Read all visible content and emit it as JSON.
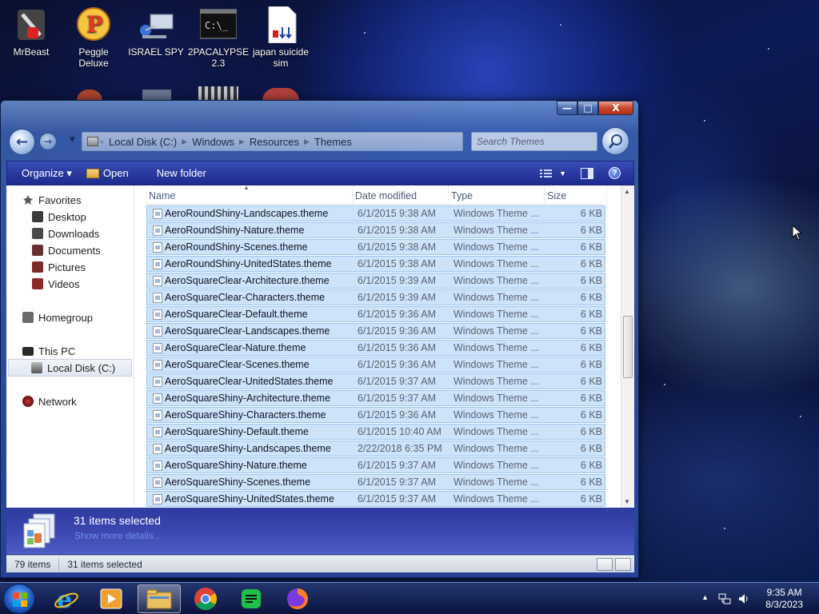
{
  "desktop": {
    "icons": [
      {
        "label": "MrBeast",
        "icon": "mrbeast-app-icon"
      },
      {
        "label": "Peggle Deluxe",
        "icon": "peggle-icon"
      },
      {
        "label": "ISRAEL SPY",
        "icon": "network-computer-icon"
      },
      {
        "label": "2PACALYPSE 2.3",
        "icon": "console-icon"
      },
      {
        "label": "japan suicide sim",
        "icon": "batch-file-icon"
      }
    ]
  },
  "window": {
    "title_buttons": {
      "minimize": "—",
      "maximize": "□",
      "close": "X"
    },
    "address": {
      "crumbs": [
        "Local Disk (C:)",
        "Windows",
        "Resources",
        "Themes"
      ],
      "overflow": "«"
    },
    "search": {
      "placeholder": "Search Themes"
    },
    "toolbar": {
      "organize": "Organize ▾",
      "open": "Open",
      "new_folder": "New folder",
      "help": "?"
    },
    "nav_pane": {
      "favorites": "Favorites",
      "desktop": "Desktop",
      "downloads": "Downloads",
      "documents": "Documents",
      "pictures": "Pictures",
      "videos": "Videos",
      "homegroup": "Homegroup",
      "this_pc": "This PC",
      "local_disk": "Local Disk (C:)",
      "network": "Network"
    },
    "columns": {
      "name": "Name",
      "date": "Date modified",
      "type": "Type",
      "size": "Size"
    },
    "files": [
      {
        "name": "AeroRoundShiny-Landscapes.theme",
        "date": "6/1/2015 9:38 AM",
        "type": "Windows Theme ...",
        "size": "6 KB"
      },
      {
        "name": "AeroRoundShiny-Nature.theme",
        "date": "6/1/2015 9:38 AM",
        "type": "Windows Theme ...",
        "size": "6 KB"
      },
      {
        "name": "AeroRoundShiny-Scenes.theme",
        "date": "6/1/2015 9:38 AM",
        "type": "Windows Theme ...",
        "size": "6 KB"
      },
      {
        "name": "AeroRoundShiny-UnitedStates.theme",
        "date": "6/1/2015 9:38 AM",
        "type": "Windows Theme ...",
        "size": "6 KB"
      },
      {
        "name": "AeroSquareClear-Architecture.theme",
        "date": "6/1/2015 9:39 AM",
        "type": "Windows Theme ...",
        "size": "6 KB"
      },
      {
        "name": "AeroSquareClear-Characters.theme",
        "date": "6/1/2015 9:39 AM",
        "type": "Windows Theme ...",
        "size": "6 KB"
      },
      {
        "name": "AeroSquareClear-Default.theme",
        "date": "6/1/2015 9:36 AM",
        "type": "Windows Theme ...",
        "size": "6 KB"
      },
      {
        "name": "AeroSquareClear-Landscapes.theme",
        "date": "6/1/2015 9:36 AM",
        "type": "Windows Theme ...",
        "size": "6 KB"
      },
      {
        "name": "AeroSquareClear-Nature.theme",
        "date": "6/1/2015 9:36 AM",
        "type": "Windows Theme ...",
        "size": "6 KB"
      },
      {
        "name": "AeroSquareClear-Scenes.theme",
        "date": "6/1/2015 9:36 AM",
        "type": "Windows Theme ...",
        "size": "6 KB"
      },
      {
        "name": "AeroSquareClear-UnitedStates.theme",
        "date": "6/1/2015 9:37 AM",
        "type": "Windows Theme ...",
        "size": "6 KB"
      },
      {
        "name": "AeroSquareShiny-Architecture.theme",
        "date": "6/1/2015 9:37 AM",
        "type": "Windows Theme ...",
        "size": "6 KB"
      },
      {
        "name": "AeroSquareShiny-Characters.theme",
        "date": "6/1/2015 9:36 AM",
        "type": "Windows Theme ...",
        "size": "6 KB"
      },
      {
        "name": "AeroSquareShiny-Default.theme",
        "date": "6/1/2015 10:40 AM",
        "type": "Windows Theme ...",
        "size": "6 KB"
      },
      {
        "name": "AeroSquareShiny-Landscapes.theme",
        "date": "2/22/2018 6:35 PM",
        "type": "Windows Theme ...",
        "size": "6 KB"
      },
      {
        "name": "AeroSquareShiny-Nature.theme",
        "date": "6/1/2015 9:37 AM",
        "type": "Windows Theme ...",
        "size": "6 KB"
      },
      {
        "name": "AeroSquareShiny-Scenes.theme",
        "date": "6/1/2015 9:37 AM",
        "type": "Windows Theme ...",
        "size": "6 KB"
      },
      {
        "name": "AeroSquareShiny-UnitedStates.theme",
        "date": "6/1/2015 9:37 AM",
        "type": "Windows Theme ...",
        "size": "6 KB"
      }
    ],
    "details": {
      "selection": "31 items selected",
      "more_link": "Show more details..."
    },
    "status": {
      "count": "79 items",
      "selected": "31 items selected"
    }
  },
  "taskbar": {
    "apps": [
      "internet-explorer-icon",
      "media-player-icon",
      "file-explorer-icon",
      "chrome-icon",
      "spotify-like-icon",
      "firefox-icon"
    ],
    "clock": {
      "time": "9:35 AM",
      "date": "8/3/2023"
    }
  },
  "colors": {
    "selection_fill": "#cde3fa",
    "selection_border": "#9ec5ee",
    "toolbar_blue": "#2a3aa0",
    "details_blue": "#3b47b0"
  }
}
